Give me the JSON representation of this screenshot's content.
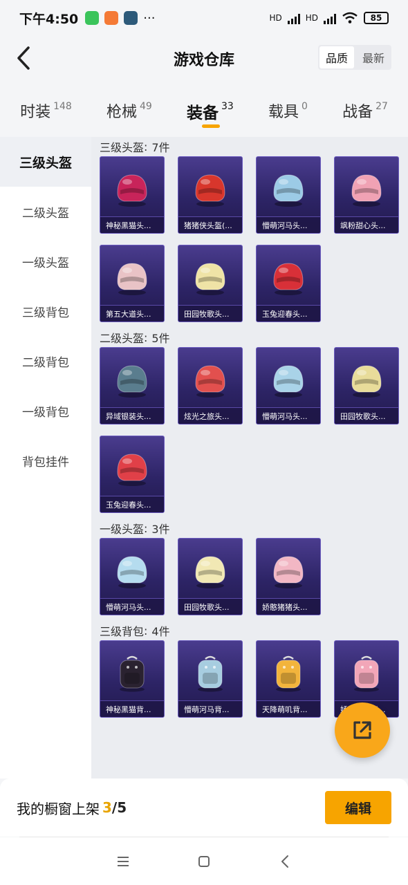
{
  "status_bar": {
    "time": "下午4:50",
    "network_1": "HD",
    "network_2": "HD",
    "battery": "85",
    "notification_icons": [
      "wechat-icon",
      "taobao-icon",
      "game-app-icon"
    ],
    "more": "···"
  },
  "header": {
    "title": "游戏仓库",
    "sort_options": [
      "品质",
      "最新"
    ],
    "sort_active": "品质"
  },
  "category_tabs": [
    {
      "label": "时装",
      "count": "148"
    },
    {
      "label": "枪械",
      "count": "49"
    },
    {
      "label": "装备",
      "count": "33",
      "active": true
    },
    {
      "label": "载具",
      "count": "0"
    },
    {
      "label": "战备",
      "count": "27"
    }
  ],
  "sidebar": {
    "items": [
      "三级头盔",
      "二级头盔",
      "一级头盔",
      "三级背包",
      "二级背包",
      "一级背包",
      "背包挂件"
    ],
    "active": "三级头盔"
  },
  "sections": [
    {
      "title": "三级头盔",
      "count_text": "7件",
      "items": [
        {
          "name": "神秘黑猫头...",
          "color": "#c8245a",
          "icon": "helmet-icon"
        },
        {
          "name": "猪猪侠头盔(...",
          "color": "#d8362c",
          "icon": "helmet-icon"
        },
        {
          "name": "懵萌河马头...",
          "color": "#9ccbe6",
          "icon": "helmet-icon"
        },
        {
          "name": "飒粉甜心头...",
          "color": "#f0a2b4",
          "icon": "helmet-icon"
        },
        {
          "name": "第五大道头...",
          "color": "#e9c3c6",
          "icon": "helmet-icon"
        },
        {
          "name": "田园牧歌头...",
          "color": "#efe3a6",
          "icon": "helmet-icon"
        },
        {
          "name": "玉兔迎春头...",
          "color": "#d83038",
          "icon": "helmet-icon"
        }
      ]
    },
    {
      "title": "二级头盔",
      "count_text": "5件",
      "items": [
        {
          "name": "异域银装头...",
          "color": "#5a7d8e",
          "icon": "helmet-icon"
        },
        {
          "name": "炫光之旅头...",
          "color": "#e2504e",
          "icon": "helmet-icon"
        },
        {
          "name": "懵萌河马头...",
          "color": "#a9d3e8",
          "icon": "helmet-icon"
        },
        {
          "name": "田园牧歌头...",
          "color": "#e8dc9a",
          "icon": "helmet-icon"
        },
        {
          "name": "玉兔迎春头...",
          "color": "#e04048",
          "icon": "helmet-icon"
        }
      ]
    },
    {
      "title": "一级头盔",
      "count_text": "3件",
      "items": [
        {
          "name": "懵萌河马头...",
          "color": "#b5dcef",
          "icon": "helmet-icon"
        },
        {
          "name": "田园牧歌头...",
          "color": "#f1e8b4",
          "icon": "helmet-icon"
        },
        {
          "name": "娇憨猪猪头...",
          "color": "#f2b7c4",
          "icon": "helmet-icon"
        }
      ]
    },
    {
      "title": "三级背包",
      "count_text": "4件",
      "items": [
        {
          "name": "神秘黑猫背...",
          "color": "#2a2230",
          "icon": "backpack-icon"
        },
        {
          "name": "懵萌河马背...",
          "color": "#a7cde0",
          "icon": "backpack-icon"
        },
        {
          "name": "天降萌叽背...",
          "color": "#f2b43c",
          "icon": "backpack-icon"
        },
        {
          "name": "娇憨猪猪背...",
          "color": "#f2a6b8",
          "icon": "backpack-icon"
        }
      ]
    }
  ],
  "floating_button": {
    "icon": "share-external-icon"
  },
  "bottom_bar": {
    "label": "我的橱窗上架",
    "current": "3",
    "separator": "/",
    "total": "5",
    "edit_label": "编辑"
  },
  "colors": {
    "accent": "#f7a400",
    "card_bg": "#2d2466"
  }
}
